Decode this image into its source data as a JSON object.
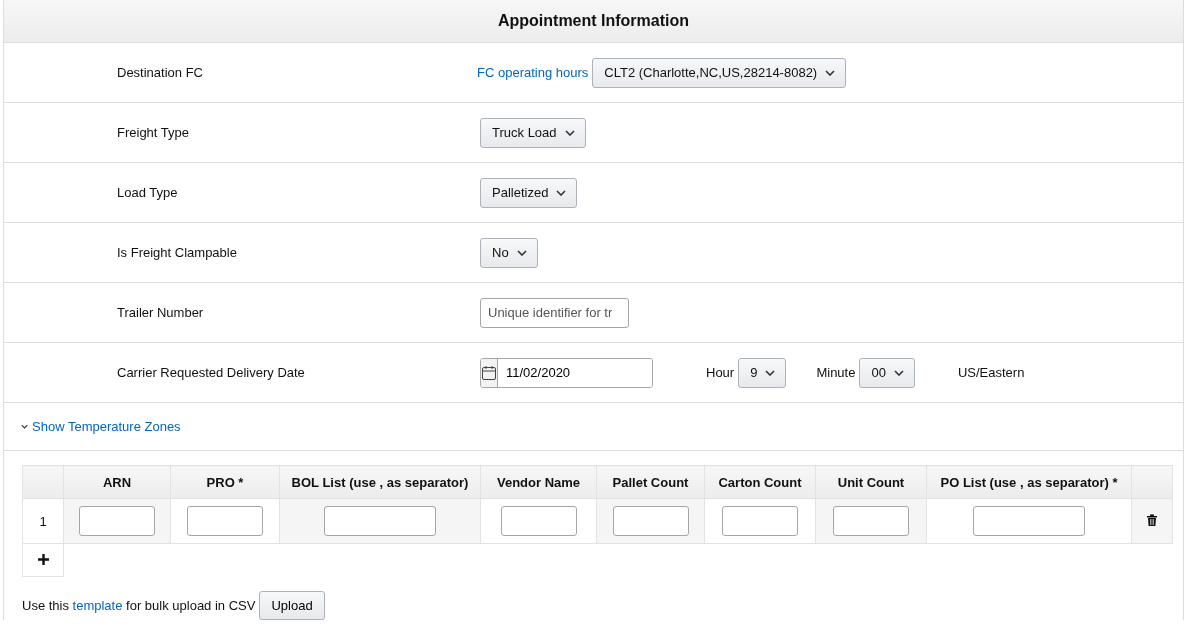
{
  "title": "Appointment Information",
  "fields": [
    {
      "label": "Destination FC",
      "kind": "link-select",
      "link": "FC operating hours",
      "value": "CLT2 (Charlotte,NC,US,28214-8082)"
    },
    {
      "label": "Freight Type",
      "kind": "select",
      "value": "Truck Load"
    },
    {
      "label": "Load Type",
      "kind": "select",
      "value": "Palletized"
    },
    {
      "label": "Is Freight Clampable",
      "kind": "select",
      "value": "No"
    },
    {
      "label": "Trailer Number",
      "kind": "text",
      "placeholder": "Unique identifier for tr"
    },
    {
      "label": "Carrier Requested Delivery Date",
      "kind": "datetime",
      "date": "11/02/2020",
      "hour_label": "Hour",
      "hour": "9",
      "minute_label": "Minute",
      "minute": "00",
      "timezone": "US/Eastern"
    }
  ],
  "temperature_toggle": {
    "label": "Show Temperature Zones",
    "expanded": false
  },
  "table": {
    "columns": [
      "ARN",
      "PRO *",
      "BOL List (use , as separator)",
      "Vendor Name",
      "Pallet Count",
      "Carton Count",
      "Unit Count",
      "PO List (use , as separator) *"
    ],
    "rows": [
      {
        "number": "1"
      }
    ]
  },
  "upload": {
    "before": "Use this",
    "link": "template",
    "after": "for bulk upload in CSV",
    "button": "Upload"
  }
}
